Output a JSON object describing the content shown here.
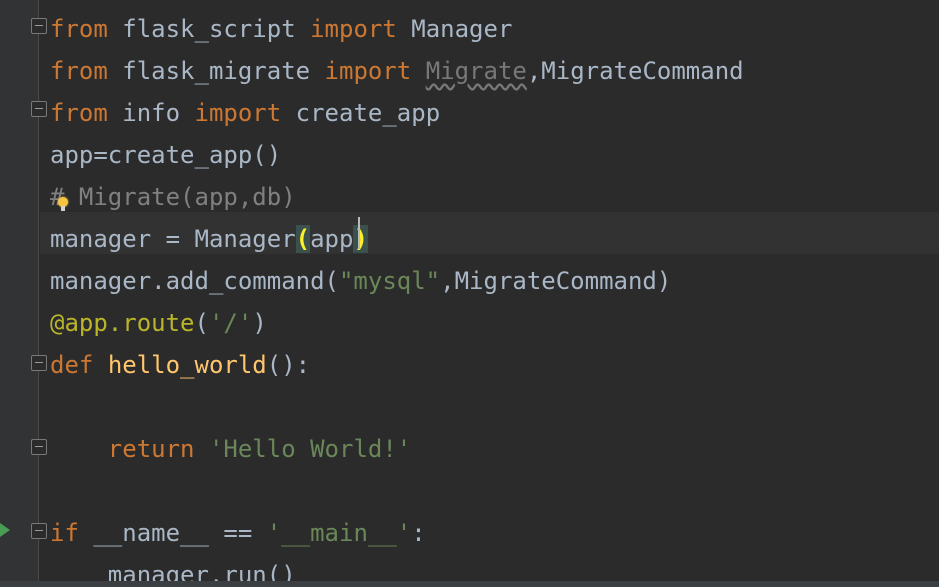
{
  "editor": {
    "lines": [
      {
        "segments": [
          {
            "t": "from",
            "c": "kw"
          },
          {
            "t": " flask_script ",
            "c": "plain"
          },
          {
            "t": "import",
            "c": "kw"
          },
          {
            "t": " Manager",
            "c": "plain"
          }
        ]
      },
      {
        "segments": [
          {
            "t": "from",
            "c": "kw"
          },
          {
            "t": " flask_migrate ",
            "c": "plain"
          },
          {
            "t": "import",
            "c": "kw"
          },
          {
            "t": " ",
            "c": "plain"
          },
          {
            "t": "Migrate",
            "c": "unused"
          },
          {
            "t": ",MigrateCommand",
            "c": "plain"
          }
        ]
      },
      {
        "segments": [
          {
            "t": "from",
            "c": "kw"
          },
          {
            "t": " info ",
            "c": "plain"
          },
          {
            "t": "import",
            "c": "kw"
          },
          {
            "t": " create_app",
            "c": "plain"
          }
        ]
      },
      {
        "segments": [
          {
            "t": "app=create_app()",
            "c": "plain"
          }
        ]
      },
      {
        "segments": [
          {
            "t": "# Migrate(app,db)",
            "c": "comment"
          }
        ]
      },
      {
        "segments": [
          {
            "t": "manager = Manager",
            "c": "plain"
          },
          {
            "t": "(",
            "c": "match"
          },
          {
            "t": "app",
            "c": "plain"
          },
          {
            "t": ")",
            "c": "match"
          }
        ]
      },
      {
        "segments": [
          {
            "t": "manager.add_command(",
            "c": "plain"
          },
          {
            "t": "\"mysql\"",
            "c": "str"
          },
          {
            "t": ",MigrateCommand)",
            "c": "plain"
          }
        ]
      },
      {
        "segments": [
          {
            "t": "@app.route",
            "c": "deco"
          },
          {
            "t": "(",
            "c": "plain"
          },
          {
            "t": "'/'",
            "c": "str"
          },
          {
            "t": ")",
            "c": "plain"
          }
        ]
      },
      {
        "segments": [
          {
            "t": "def",
            "c": "kw"
          },
          {
            "t": " ",
            "c": "plain"
          },
          {
            "t": "hello_world",
            "c": "fn"
          },
          {
            "t": "():",
            "c": "plain"
          }
        ]
      },
      {
        "segments": [
          {
            "t": "",
            "c": "plain"
          }
        ]
      },
      {
        "segments": [
          {
            "t": "    ",
            "c": "plain"
          },
          {
            "t": "return",
            "c": "kw"
          },
          {
            "t": " ",
            "c": "plain"
          },
          {
            "t": "'Hello World!'",
            "c": "str"
          }
        ]
      },
      {
        "segments": [
          {
            "t": "",
            "c": "plain"
          }
        ]
      },
      {
        "segments": [
          {
            "t": "if",
            "c": "kw"
          },
          {
            "t": " __name__ == ",
            "c": "plain"
          },
          {
            "t": "'__main__'",
            "c": "str"
          },
          {
            "t": ":",
            "c": "plain"
          }
        ]
      },
      {
        "segments": [
          {
            "t": "    manager.run()",
            "c": "plain"
          }
        ]
      }
    ],
    "colors": {
      "background": "#2b2b2b",
      "gutter": "#313335",
      "keyword": "#cc7832",
      "function": "#ffc66d",
      "string": "#6a8759",
      "decorator": "#bbb529",
      "comment": "#808080",
      "plain": "#a9b7c6"
    },
    "icons": [
      "fold-icon",
      "run-icon",
      "lightbulb-icon"
    ]
  }
}
